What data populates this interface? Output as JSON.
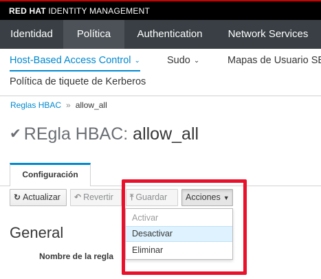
{
  "brand": {
    "bold": "RED HAT",
    "rest": "IDENTITY MANAGEMENT"
  },
  "topnav": {
    "items": [
      {
        "label": "Identidad"
      },
      {
        "label": "Política"
      },
      {
        "label": "Authentication"
      },
      {
        "label": "Network Services"
      }
    ],
    "active": "Política"
  },
  "subnav": {
    "items": [
      {
        "label": "Host-Based Access Control",
        "dropdown": true
      },
      {
        "label": "Sudo",
        "dropdown": true
      },
      {
        "label": "Mapas de Usuario SE"
      },
      {
        "label": "Política de tiquete de Kerberos"
      }
    ],
    "active": "Host-Based Access Control"
  },
  "breadcrumb": {
    "parent": "Reglas HBAC",
    "separator": "»",
    "current": "allow_all"
  },
  "title": {
    "prefix": "REgla HBAC:",
    "name": "allow_all"
  },
  "tabs": [
    {
      "label": "Configuración"
    }
  ],
  "toolbar": {
    "refresh_label": "Actualizar",
    "revert_label": "Revertir",
    "save_label": "Guardar",
    "actions_label": "Acciones"
  },
  "actions_menu": {
    "items": [
      {
        "label": "Activar",
        "disabled": true
      },
      {
        "label": "Desactivar",
        "hover": true
      },
      {
        "label": "Eliminar"
      }
    ]
  },
  "section": {
    "title": "General"
  },
  "fields": {
    "rule_name_label": "Nombre de la regla"
  },
  "colors": {
    "brand_bar": "#000000",
    "brand_accent": "#cc0000",
    "nav_bg": "#393f44",
    "nav_active": "#4d5258",
    "link": "#0088ce",
    "highlight": "#e8102a",
    "menu_hover": "#def3ff"
  }
}
